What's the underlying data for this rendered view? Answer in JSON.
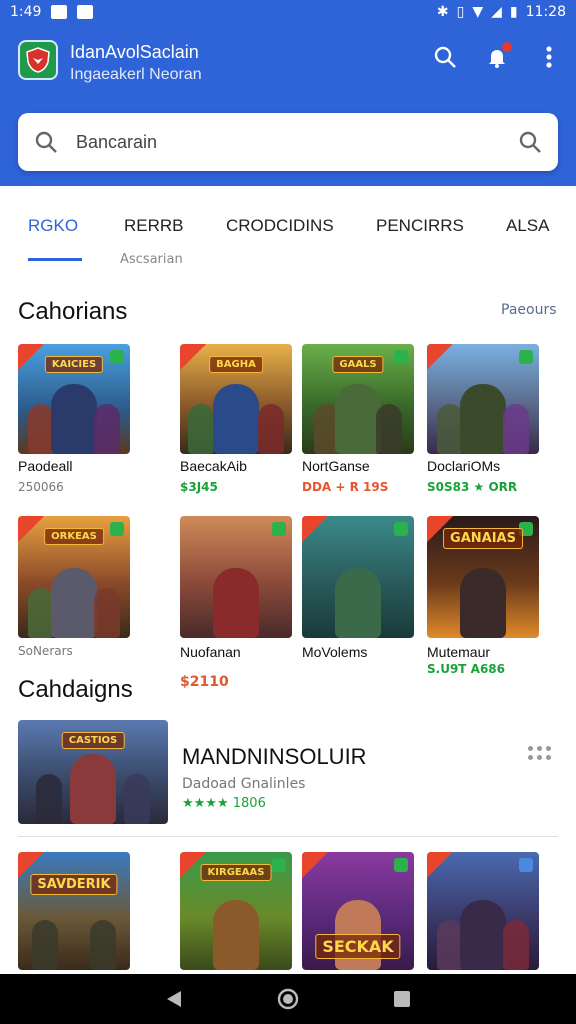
{
  "status_bar": {
    "time": "1:49",
    "clock_right": "11:28"
  },
  "app_bar": {
    "title": "IdanAvolSaclain",
    "subtitle": "Ingaeakerl Neoran",
    "icons": [
      "search-icon",
      "notification-icon",
      "more-vert-icon"
    ],
    "accent": "#2f63d8"
  },
  "search": {
    "value": "Bancarain",
    "placeholder": "Bancarain"
  },
  "tabs": {
    "items": [
      {
        "label": "RGKO",
        "active": true
      },
      {
        "label": "RERRB",
        "active": false
      },
      {
        "label": "CRODCIDINS",
        "active": false
      },
      {
        "label": "PENCIRRS",
        "active": false
      },
      {
        "label": "ALSA",
        "active": false
      }
    ],
    "sub_label": "Ascsarian"
  },
  "section1": {
    "title": "Cahorians",
    "link": "Paeours",
    "row1": [
      {
        "banner": "KAICIES",
        "title": "Paodeall",
        "meta": "250066",
        "meta_style": "grey"
      },
      {
        "banner": "BAGHA",
        "title": "BaecakAib",
        "meta": "$3J45",
        "meta_style": "green"
      },
      {
        "banner": "GAALS",
        "title": "NortGanse",
        "meta": "DDA + R 19S",
        "meta_style": "orange"
      },
      {
        "banner": "",
        "title": "DoclariOMs",
        "meta": "S0S83 ★ ORR",
        "meta_style": "green"
      }
    ],
    "row2": [
      {
        "banner": "ORKEAS",
        "title": "",
        "meta": "SoNerars",
        "meta_style": "grey"
      },
      {
        "banner": "",
        "title": "Nuofanan",
        "meta": "$2110",
        "meta_style": "orange"
      },
      {
        "banner": "",
        "title": "MoVolems",
        "meta": "",
        "meta_style": "grey"
      },
      {
        "banner": "GANAIAS",
        "title": "Mutemaur",
        "meta": "S.U9T A686",
        "meta_style": "green"
      }
    ]
  },
  "section2": {
    "title": "Cahdaigns",
    "featured": {
      "banner": "CASTIOS",
      "title": "MANDNINSOLUIR",
      "subtitle": "Dadoad Gnalinles",
      "rating": "★★★★ 1806"
    },
    "row": [
      {
        "banner": "SAVDERIK"
      },
      {
        "banner": "KIRGEAAS"
      },
      {
        "banner": "SECKAK"
      },
      {
        "banner": ""
      }
    ]
  }
}
